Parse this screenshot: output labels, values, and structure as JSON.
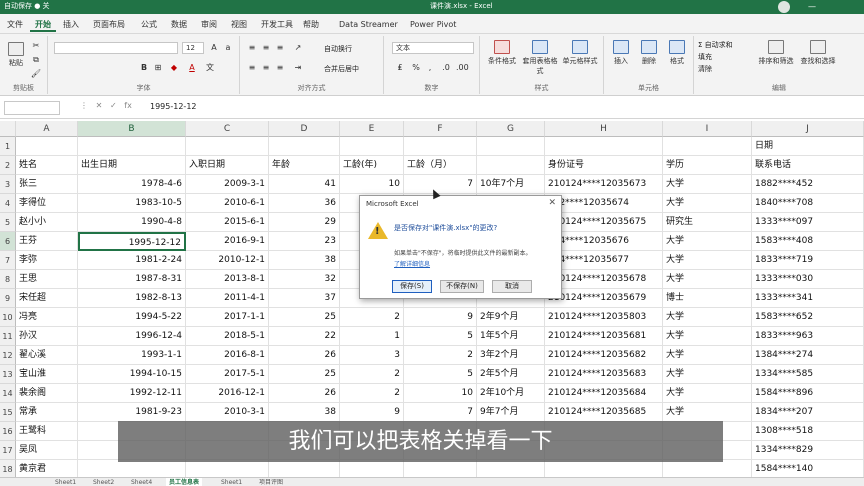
{
  "titlebar": {
    "left": "自动保存 ● 关",
    "title": "课件演.xlsx - Excel"
  },
  "tabs": [
    "文件",
    "开始",
    "插入",
    "页面布局",
    "公式",
    "数据",
    "审阅",
    "视图",
    "开发工具",
    "帮助",
    "Data Streamer",
    "Power Pivot"
  ],
  "ribbon": {
    "clipboard_label": "剪贴板",
    "paste": "粘贴",
    "font_label": "字体",
    "font_size": "12",
    "align_label": "对齐方式",
    "wrap": "自动换行",
    "merge": "合并后居中",
    "number_label": "数字",
    "number_format": "文本",
    "styles_label": "样式",
    "cond_format": "条件格式",
    "table_format": "套用表格格式",
    "cell_style": "单元格样式",
    "cells_label": "单元格",
    "insert": "插入",
    "delete": "删除",
    "format": "格式",
    "edit_label": "编辑",
    "autosum": "Σ 自动求和",
    "fill": "填充",
    "clear": "清除",
    "sort": "排序和筛选",
    "find": "查找和选择"
  },
  "formula": {
    "content": "1995-12-12"
  },
  "columns": [
    "A",
    "B",
    "C",
    "D",
    "E",
    "F",
    "G",
    "H",
    "I",
    "J"
  ],
  "headers": {
    "name": "姓名",
    "birth": "出生日期",
    "hire": "入职日期",
    "age": "年龄",
    "years": "工龄(年)",
    "months": "工龄（月）",
    "tenure": "",
    "id": "身份证号",
    "edu": "学历",
    "phone": "联系电话",
    "j1": "日期"
  },
  "rows": [
    {
      "name": "张三",
      "birth": "1978-4-6",
      "hire": "2009-3-1",
      "age": "41",
      "years": "10",
      "months": "7",
      "tenure": "10年7个月",
      "id": "210124****12035673",
      "edu": "大学",
      "phone": "1882****452"
    },
    {
      "name": "李得位",
      "birth": "1983-10-5",
      "hire": "2010-6-1",
      "age": "36",
      "years": "",
      "months": "",
      "tenure": "",
      "id": "652****12035674",
      "edu": "大学",
      "phone": "1840****708"
    },
    {
      "name": "赵小小",
      "birth": "1990-4-8",
      "hire": "2015-6-1",
      "age": "29",
      "years": "",
      "months": "",
      "tenure": "",
      "id": "210124****12035675",
      "edu": "研究生",
      "phone": "1333****097"
    },
    {
      "name": "王芬",
      "birth": "1995-12-12",
      "hire": "2016-9-1",
      "age": "23",
      "years": "",
      "months": "",
      "tenure": "",
      "id": "144****12035676",
      "edu": "大学",
      "phone": "1583****408"
    },
    {
      "name": "李弥",
      "birth": "1981-2-24",
      "hire": "2010-12-1",
      "age": "38",
      "years": "",
      "months": "",
      "tenure": "",
      "id": "674****12035677",
      "edu": "大学",
      "phone": "1833****719"
    },
    {
      "name": "王思",
      "birth": "1987-8-31",
      "hire": "2013-8-1",
      "age": "32",
      "years": "",
      "months": "",
      "tenure": "",
      "id": "210124****12035678",
      "edu": "大学",
      "phone": "1333****030"
    },
    {
      "name": "宋任超",
      "birth": "1982-8-13",
      "hire": "2011-4-1",
      "age": "37",
      "years": "",
      "months": "",
      "tenure": "",
      "id": "210124****12035679",
      "edu": "博士",
      "phone": "1333****341"
    },
    {
      "name": "冯亮",
      "birth": "1994-5-22",
      "hire": "2017-1-1",
      "age": "25",
      "years": "2",
      "months": "9",
      "tenure": "2年9个月",
      "id": "210124****12035803",
      "edu": "大学",
      "phone": "1583****652"
    },
    {
      "name": "孙汉",
      "birth": "1996-12-4",
      "hire": "2018-5-1",
      "age": "22",
      "years": "1",
      "months": "5",
      "tenure": "1年5个月",
      "id": "210124****12035681",
      "edu": "大学",
      "phone": "1833****963"
    },
    {
      "name": "翟心溪",
      "birth": "1993-1-1",
      "hire": "2016-8-1",
      "age": "26",
      "years": "3",
      "months": "2",
      "tenure": "3年2个月",
      "id": "210124****12035682",
      "edu": "大学",
      "phone": "1384****274"
    },
    {
      "name": "宝山淮",
      "birth": "1994-10-15",
      "hire": "2017-5-1",
      "age": "25",
      "years": "2",
      "months": "5",
      "tenure": "2年5个月",
      "id": "210124****12035683",
      "edu": "大学",
      "phone": "1334****585"
    },
    {
      "name": "裴余阁",
      "birth": "1992-12-11",
      "hire": "2016-12-1",
      "age": "26",
      "years": "2",
      "months": "10",
      "tenure": "2年10个月",
      "id": "210124****12035684",
      "edu": "大学",
      "phone": "1584****896"
    },
    {
      "name": "常承",
      "birth": "1981-9-23",
      "hire": "2010-3-1",
      "age": "38",
      "years": "9",
      "months": "7",
      "tenure": "9年7个月",
      "id": "210124****12035685",
      "edu": "大学",
      "phone": "1834****207"
    },
    {
      "name": "王鹭科",
      "birth": "",
      "hire": "",
      "age": "",
      "years": "",
      "months": "",
      "tenure": "",
      "id": "",
      "edu": "",
      "phone": "1308****518"
    },
    {
      "name": "吴凤",
      "birth": "",
      "hire": "",
      "age": "",
      "years": "",
      "months": "",
      "tenure": "",
      "id": "",
      "edu": "",
      "phone": "1334****829"
    },
    {
      "name": "黄京君",
      "birth": "",
      "hire": "",
      "age": "",
      "years": "",
      "months": "",
      "tenure": "",
      "id": "",
      "edu": "",
      "phone": "1584****140"
    }
  ],
  "dialog": {
    "title": "Microsoft Excel",
    "question": "是否保存对\"课件演.xlsx\"的更改?",
    "message": "如果单击\"不保存\"，将临时提供此文件的最新副本。",
    "link": "了解详细信息",
    "save": "保存(S)",
    "dont_save": "不保存(N)",
    "cancel": "取消"
  },
  "subtitle": "我们可以把表格关掉看一下",
  "sheets": [
    "Sheet1",
    "Sheet2",
    "Sheet4",
    "员工信息表",
    "Sheet1",
    "项目评图"
  ]
}
